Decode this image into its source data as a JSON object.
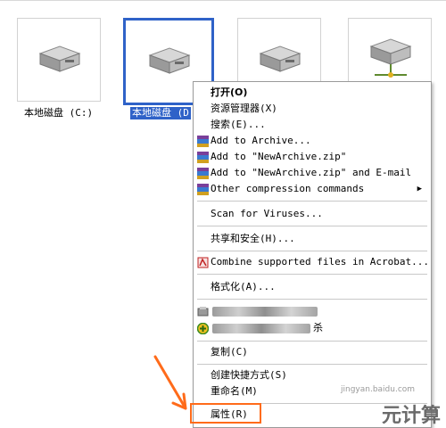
{
  "drives": [
    {
      "label": "本地磁盘 (C:)",
      "selected": false
    },
    {
      "label": "本地磁盘 (D",
      "selected": true
    },
    {
      "label": "",
      "selected": false
    },
    {
      "label": "",
      "selected": false
    }
  ],
  "context_menu": {
    "open": "打开(O)",
    "explorer": "资源管理器(X)",
    "search": "搜索(E)...",
    "add_archive": "Add to Archive...",
    "add_newarchive": "Add to \"NewArchive.zip\"",
    "add_email": "Add to \"NewArchive.zip\" and E-mail",
    "other_compression": "Other compression commands",
    "scan_viruses": "Scan for Viruses...",
    "share_security": "共享和安全(H)...",
    "combine_acrobat": "Combine supported files in Acrobat...",
    "format": "格式化(A)...",
    "blurred_2_suffix": "杀",
    "copy": "复制(C)",
    "create_shortcut": "创建快捷方式(S)",
    "rename": "重命名(M)",
    "properties": "属性(R)"
  },
  "colors": {
    "selection": "#2f62c8",
    "highlight": "#ff6b1a"
  },
  "watermark": {
    "main": "元计算",
    "small": "jingyan.baidu.com"
  }
}
